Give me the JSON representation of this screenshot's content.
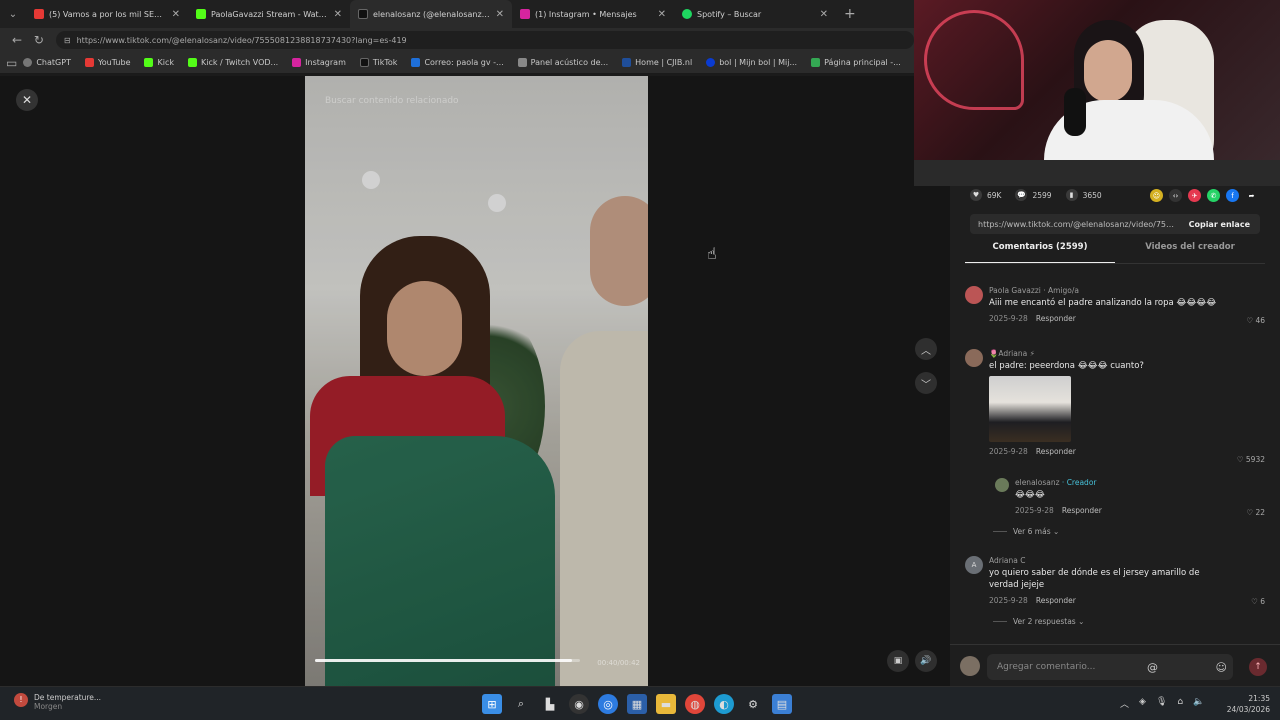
{
  "browser": {
    "tabs": [
      {
        "title": "(5) Vamos a por los mil SEGUIDORES",
        "color": "#e53935"
      },
      {
        "title": "PaolaGavazzi Stream - Watch Live",
        "color": "#53fc18"
      },
      {
        "title": "elenalosanz (@elenalosanz) | TikTok",
        "color": "#111111"
      },
      {
        "title": "(1) Instagram • Mensajes",
        "color": "#d6249f"
      },
      {
        "title": "Spotify – Buscar",
        "color": "#1ed760"
      }
    ],
    "url": "https://www.tiktok.com/@elenalosanz/video/7555081238818737430?lang=es-419",
    "bookmarks": [
      {
        "label": "ChatGPT",
        "color": "#777777"
      },
      {
        "label": "YouTube",
        "color": "#e53935"
      },
      {
        "label": "Kick",
        "color": "#53fc18"
      },
      {
        "label": "Kick / Twitch VOD...",
        "color": "#53fc18"
      },
      {
        "label": "Instagram",
        "color": "#d6249f"
      },
      {
        "label": "TikTok",
        "color": "#111111"
      },
      {
        "label": "Correo: paola gv -...",
        "color": "#1e6fd9"
      },
      {
        "label": "Panel acústico de...",
        "color": "#888888"
      },
      {
        "label": "Home | CJIB.nl",
        "color": "#1f4e9a"
      },
      {
        "label": "bol | Mijn bol | Mij...",
        "color": "#0a3bd1"
      },
      {
        "label": "Página principal -...",
        "color": "#34a853"
      }
    ]
  },
  "video": {
    "search_placeholder": "Buscar contenido relacionado",
    "timecode": "00:40/00:42",
    "progress_fraction": 0.97
  },
  "stats": {
    "likes": "69K",
    "comments": "2599",
    "saves": "3650"
  },
  "link": {
    "url": "https://www.tiktok.com/@elenalosanz/video/7555...",
    "copy_label": "Copiar enlace"
  },
  "panel_tabs": {
    "comments": "Comentarios (2599)",
    "creator_videos": "Videos del creador"
  },
  "comments": [
    {
      "author": "Paola Gavazzi · Amigo/a",
      "text": "Aiii me encantó el padre analizando la ropa 😂😂😂😂",
      "date": "2025-9-28",
      "reply": "Responder",
      "likes": "46",
      "avatar": "#b55"
    },
    {
      "author": "🌷Adriana ⚡",
      "text": "el padre: peeerdona 😂😂😂 cuanto?",
      "date": "2025-9-28",
      "reply": "Responder",
      "likes": "5932",
      "avatar": "#8a6a5a"
    },
    {
      "author": "elenalosanz",
      "creator_tag": "· Creador",
      "text": "😂😂😂",
      "date": "2025-9-28",
      "reply": "Responder",
      "likes": "22",
      "avatar": "#6a7a5a"
    },
    {
      "author": "Adriana C",
      "text": "yo quiero saber de dónde es el jersey amarillo de verdad jejeje",
      "date": "2025-9-28",
      "reply": "Responder",
      "likes": "6",
      "avatar": "#6a6f75",
      "initial": "A"
    }
  ],
  "more_replies": [
    "Ver 6 más",
    "Ver 2 respuestas"
  ],
  "composer": {
    "placeholder": "Agregar comentario..."
  },
  "taskbar": {
    "weather_title": "De temperature...",
    "weather_sub": "Morgen",
    "time": "21:35",
    "date": "24/03/2026"
  }
}
